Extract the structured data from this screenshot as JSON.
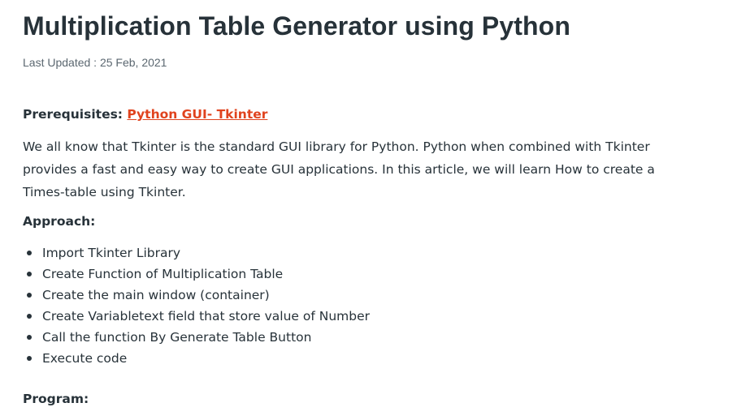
{
  "article": {
    "title": "Multiplication Table Generator using Python",
    "last_updated": "Last Updated : 25 Feb, 2021",
    "prerequisites": {
      "label": "Prerequisites: ",
      "link_text": "Python GUI- Tkinter"
    },
    "intro": "We all know that Tkinter is the standard GUI library for Python. Python when combined with Tkinter provides a fast and easy way to create GUI applications. In this article, we will learn How to create a Times-table using Tkinter.",
    "approach_heading": "Approach:",
    "steps": [
      "Import Tkinter Library",
      "Create Function of Multiplication Table",
      "Create the main window (container)",
      "Create Variabletext field that store value of Number",
      "Call the function By Generate Table Button",
      "Execute code"
    ],
    "program_heading": "Program:"
  },
  "colors": {
    "text": "#273239",
    "muted": "#5b6770",
    "link": "#e0431e",
    "background": "#ffffff"
  }
}
